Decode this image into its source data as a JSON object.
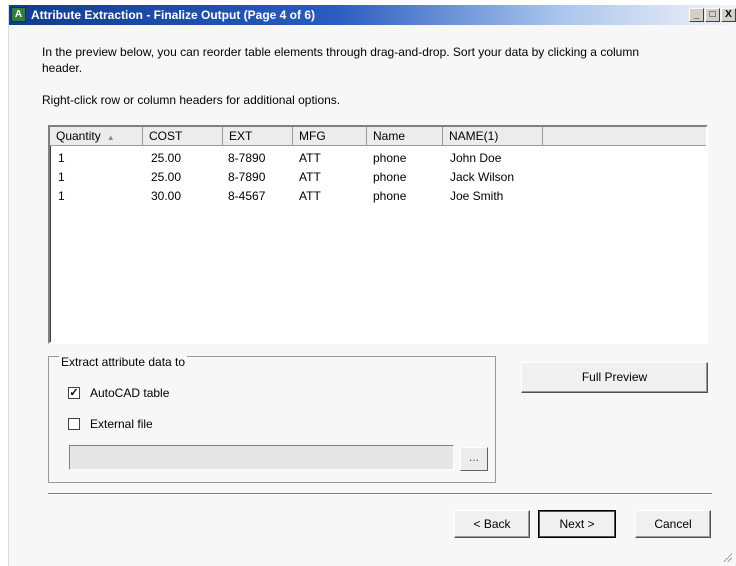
{
  "window": {
    "title": "Attribute Extraction - Finalize Output (Page 4 of 6)",
    "app_icon": "attribute-extraction-icon",
    "controls": {
      "minimize": "_",
      "maximize": "□",
      "close": "X"
    }
  },
  "instructions": {
    "intro": "In the preview below, you can reorder table elements through drag-and-drop. Sort your data by clicking a column header.",
    "right_click": "Right-click row or column headers for additional options."
  },
  "table": {
    "columns": [
      "Quantity",
      "COST",
      "EXT",
      "MFG",
      "Name",
      "NAME(1)"
    ],
    "sort_indicator": "▲",
    "rows": [
      [
        "1",
        "25.00",
        "8-7890",
        "ATT",
        "phone",
        "John Doe"
      ],
      [
        "1",
        "25.00",
        "8-7890",
        "ATT",
        "phone",
        "Jack Wilson"
      ],
      [
        "1",
        "30.00",
        "8-4567",
        "ATT",
        "phone",
        "Joe Smith"
      ]
    ]
  },
  "extract": {
    "group_label": "Extract attribute data to",
    "autocad_table": {
      "label": "AutoCAD table",
      "checked": true
    },
    "external_file": {
      "label": "External file",
      "checked": false
    },
    "file_path": "",
    "browse_label": "..."
  },
  "buttons": {
    "full_preview": "Full Preview",
    "back": "< Back",
    "next": "Next >",
    "cancel": "Cancel"
  },
  "colors": {
    "title_start": "#123c8e",
    "title_end": "#f2f4f8",
    "dialog_bg": "#f7f7f7"
  }
}
